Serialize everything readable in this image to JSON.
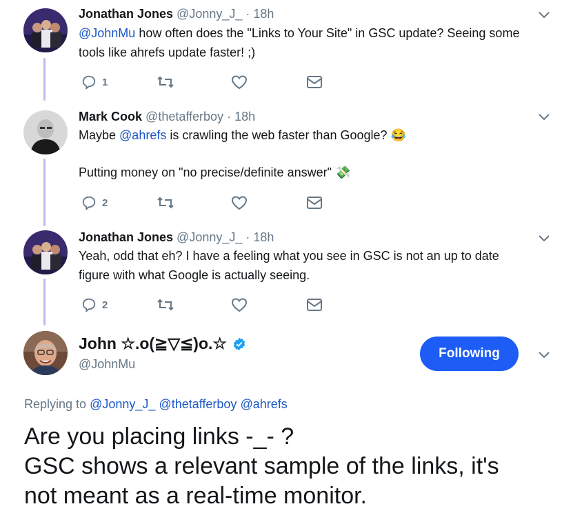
{
  "tweets": [
    {
      "name": "Jonathan Jones",
      "handle": "@Jonny_J_",
      "dot": "·",
      "time": "18h",
      "mention": "@JohnMu",
      "text": " how often does the \"Links to Your Site\" in GSC update? Seeing some tools like ahrefs update faster! ;)",
      "reply_count": "1",
      "retweet_count": "",
      "like_count": ""
    },
    {
      "name": "Mark Cook",
      "handle": "@thetafferboy",
      "dot": "·",
      "time": "18h",
      "text_pre": "Maybe ",
      "mention": "@ahrefs",
      "text_post": " is crawling the web faster than Google? ",
      "emoji1": "😂",
      "line2": "Putting money on \"no precise/definite answer\" ",
      "emoji2": "💸",
      "reply_count": "2"
    },
    {
      "name": "Jonathan Jones",
      "handle": "@Jonny_J_",
      "dot": "·",
      "time": "18h",
      "text": "Yeah, odd that eh? I have a feeling what you see in GSC is not an up to date figure with what Google is actually seeing.",
      "reply_count": "2"
    }
  ],
  "main": {
    "name": "John ☆.o(≧▽≦)o.☆",
    "handle": "@JohnMu",
    "follow_label": "Following",
    "replying_label": "Replying to",
    "replying_to": [
      "@Jonny_J_",
      "@thetafferboy",
      "@ahrefs"
    ],
    "text_lines": [
      "Are you placing links -_- ?",
      "GSC shows a relevant sample of the links, it's",
      "not meant as a real-time monitor."
    ]
  },
  "colors": {
    "accent": "#1d5cf5",
    "mention": "#1b57c7",
    "muted": "#657786",
    "thread": "#c4b5f0",
    "verified": "#1da1f2"
  },
  "icons": [
    "reply-icon",
    "retweet-icon",
    "like-icon",
    "message-icon",
    "chevron-down-icon",
    "verified-badge-icon"
  ]
}
